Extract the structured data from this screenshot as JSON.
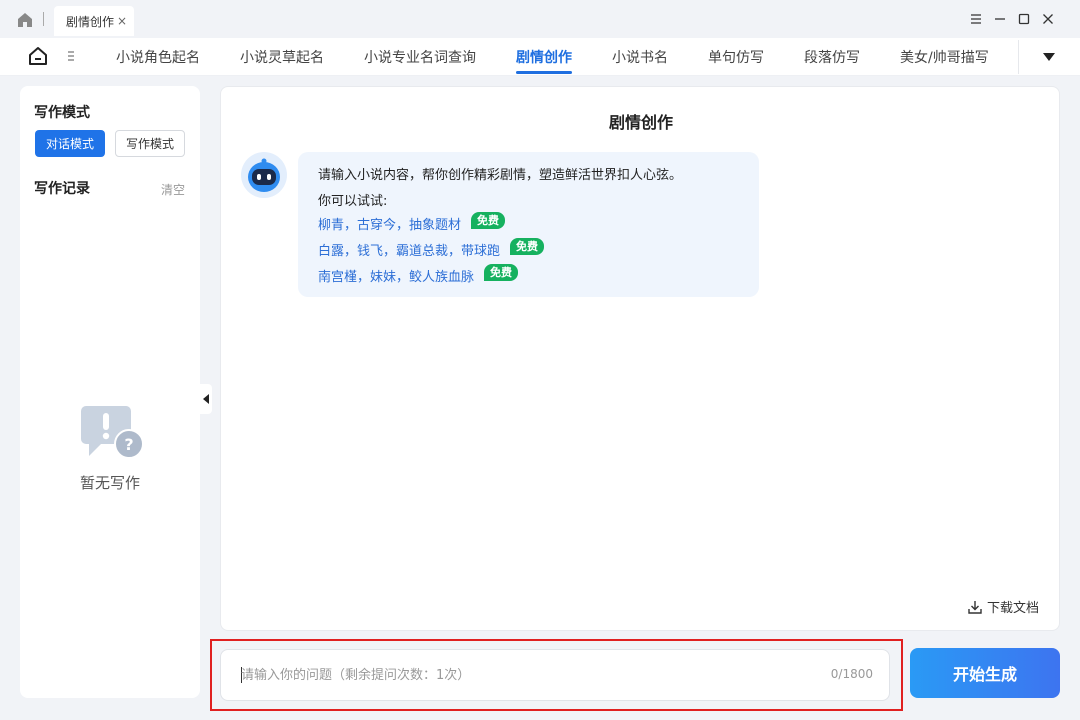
{
  "window": {
    "tab_title": "剧情创作",
    "tab_close": "×"
  },
  "nav": {
    "items": [
      {
        "label": "小说角色起名",
        "active": false
      },
      {
        "label": "小说灵草起名",
        "active": false
      },
      {
        "label": "小说专业名词查询",
        "active": false
      },
      {
        "label": "剧情创作",
        "active": true
      },
      {
        "label": "小说书名",
        "active": false
      },
      {
        "label": "单句仿写",
        "active": false
      },
      {
        "label": "段落仿写",
        "active": false
      },
      {
        "label": "美女/帅哥描写",
        "active": false
      }
    ],
    "accent_color": "#1f6fe0"
  },
  "sidebar": {
    "mode_title": "写作模式",
    "mode_dialog": "对话模式",
    "mode_writing": "写作模式",
    "records_title": "写作记录",
    "clear_label": "清空",
    "empty_text": "暂无写作"
  },
  "main": {
    "title": "剧情创作",
    "intro": "请输入小说内容，帮你创作精彩剧情，塑造鲜活世界扣人心弦。",
    "try_label": "你可以试试:",
    "suggestions": [
      {
        "text": "柳青，古穿今，抽象题材",
        "badge": "免费"
      },
      {
        "text": "白露，钱飞，霸道总裁，带球跑",
        "badge": "免费"
      },
      {
        "text": "南宫槿，妹妹，鲛人族血脉",
        "badge": "免费"
      }
    ],
    "download_label": "下载文档"
  },
  "input": {
    "placeholder": "请输入你的问题（剩余提问次数：1次）",
    "value": "",
    "counter": "0/1800"
  },
  "generate_button": "开始生成"
}
